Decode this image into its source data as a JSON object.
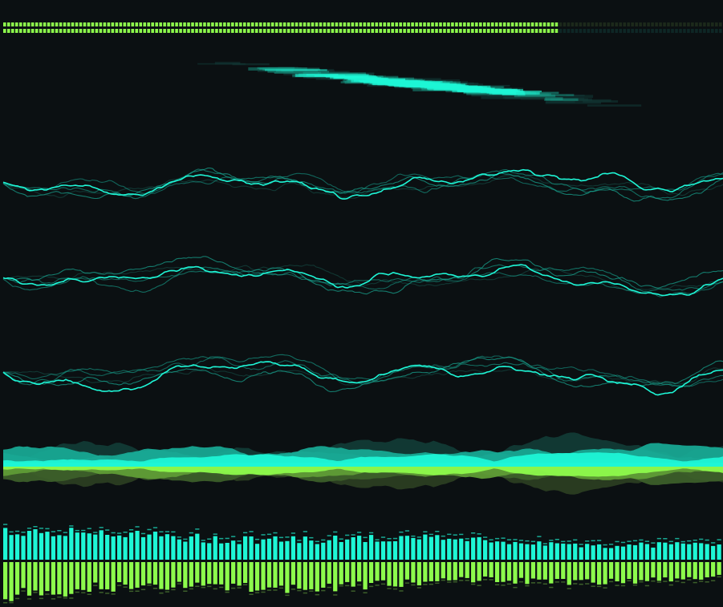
{
  "app": {
    "colors": {
      "background": "#0b1012",
      "accent_cyan": "#1ef6d6",
      "accent_teal": "#18a893",
      "accent_green": "#8dfa4c",
      "dim_green": "#2b3e22",
      "dim_teal": "#123b36"
    }
  },
  "progress": {
    "fraction": 0.77,
    "segments": 180
  },
  "waveforms": {
    "trace_count": 5,
    "panels": 3
  },
  "area_meter": {
    "layers": 4
  },
  "bar_meter": {
    "bar_count": 120
  }
}
